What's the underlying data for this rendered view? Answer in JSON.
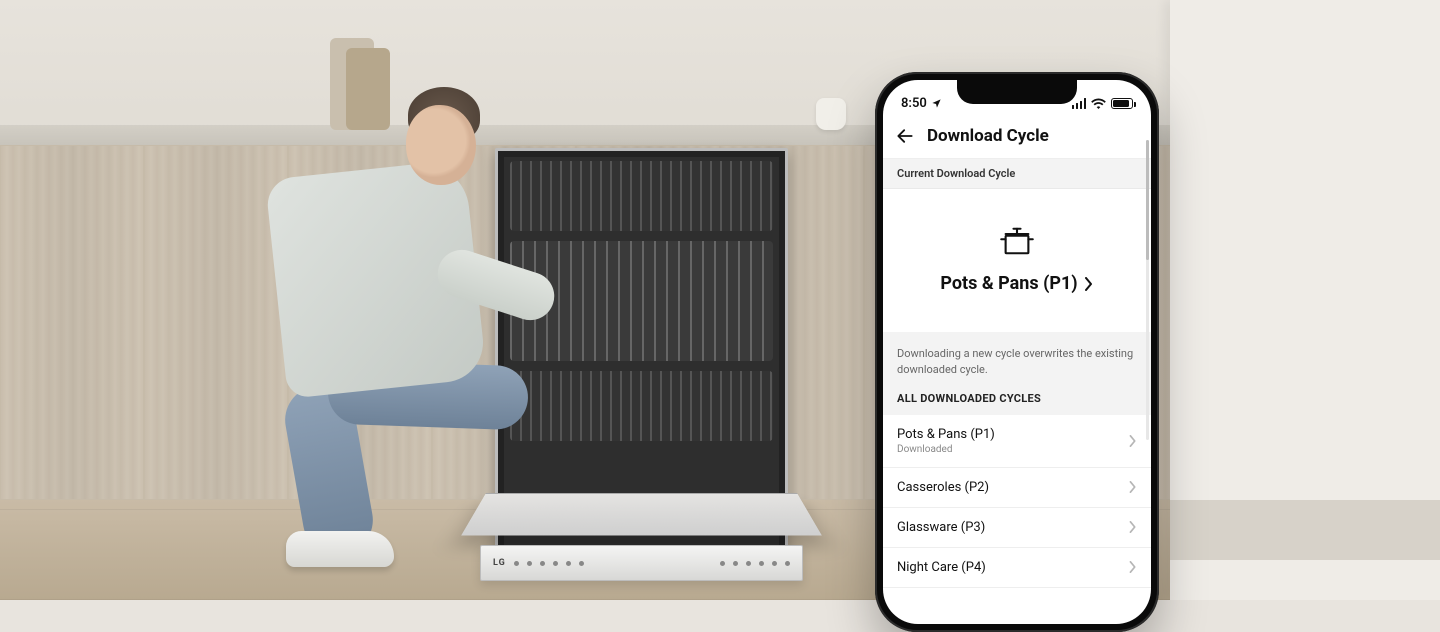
{
  "status_bar": {
    "time": "8:50",
    "location_indicator": "location-arrow"
  },
  "header": {
    "title": "Download Cycle"
  },
  "current_section": {
    "heading": "Current Download Cycle",
    "cycle_name": "Pots & Pans (P1)",
    "icon": "pot-icon"
  },
  "note": "Downloading a new cycle overwrites the existing downloaded cycle.",
  "all_section_heading": "ALL DOWNLOADED CYCLES",
  "cycles": [
    {
      "name": "Pots & Pans (P1)",
      "status": "Downloaded"
    },
    {
      "name": "Casseroles (P2)",
      "status": ""
    },
    {
      "name": "Glassware (P3)",
      "status": ""
    },
    {
      "name": "Night Care (P4)",
      "status": ""
    }
  ],
  "dishwasher_panel": {
    "brand": "LG"
  }
}
